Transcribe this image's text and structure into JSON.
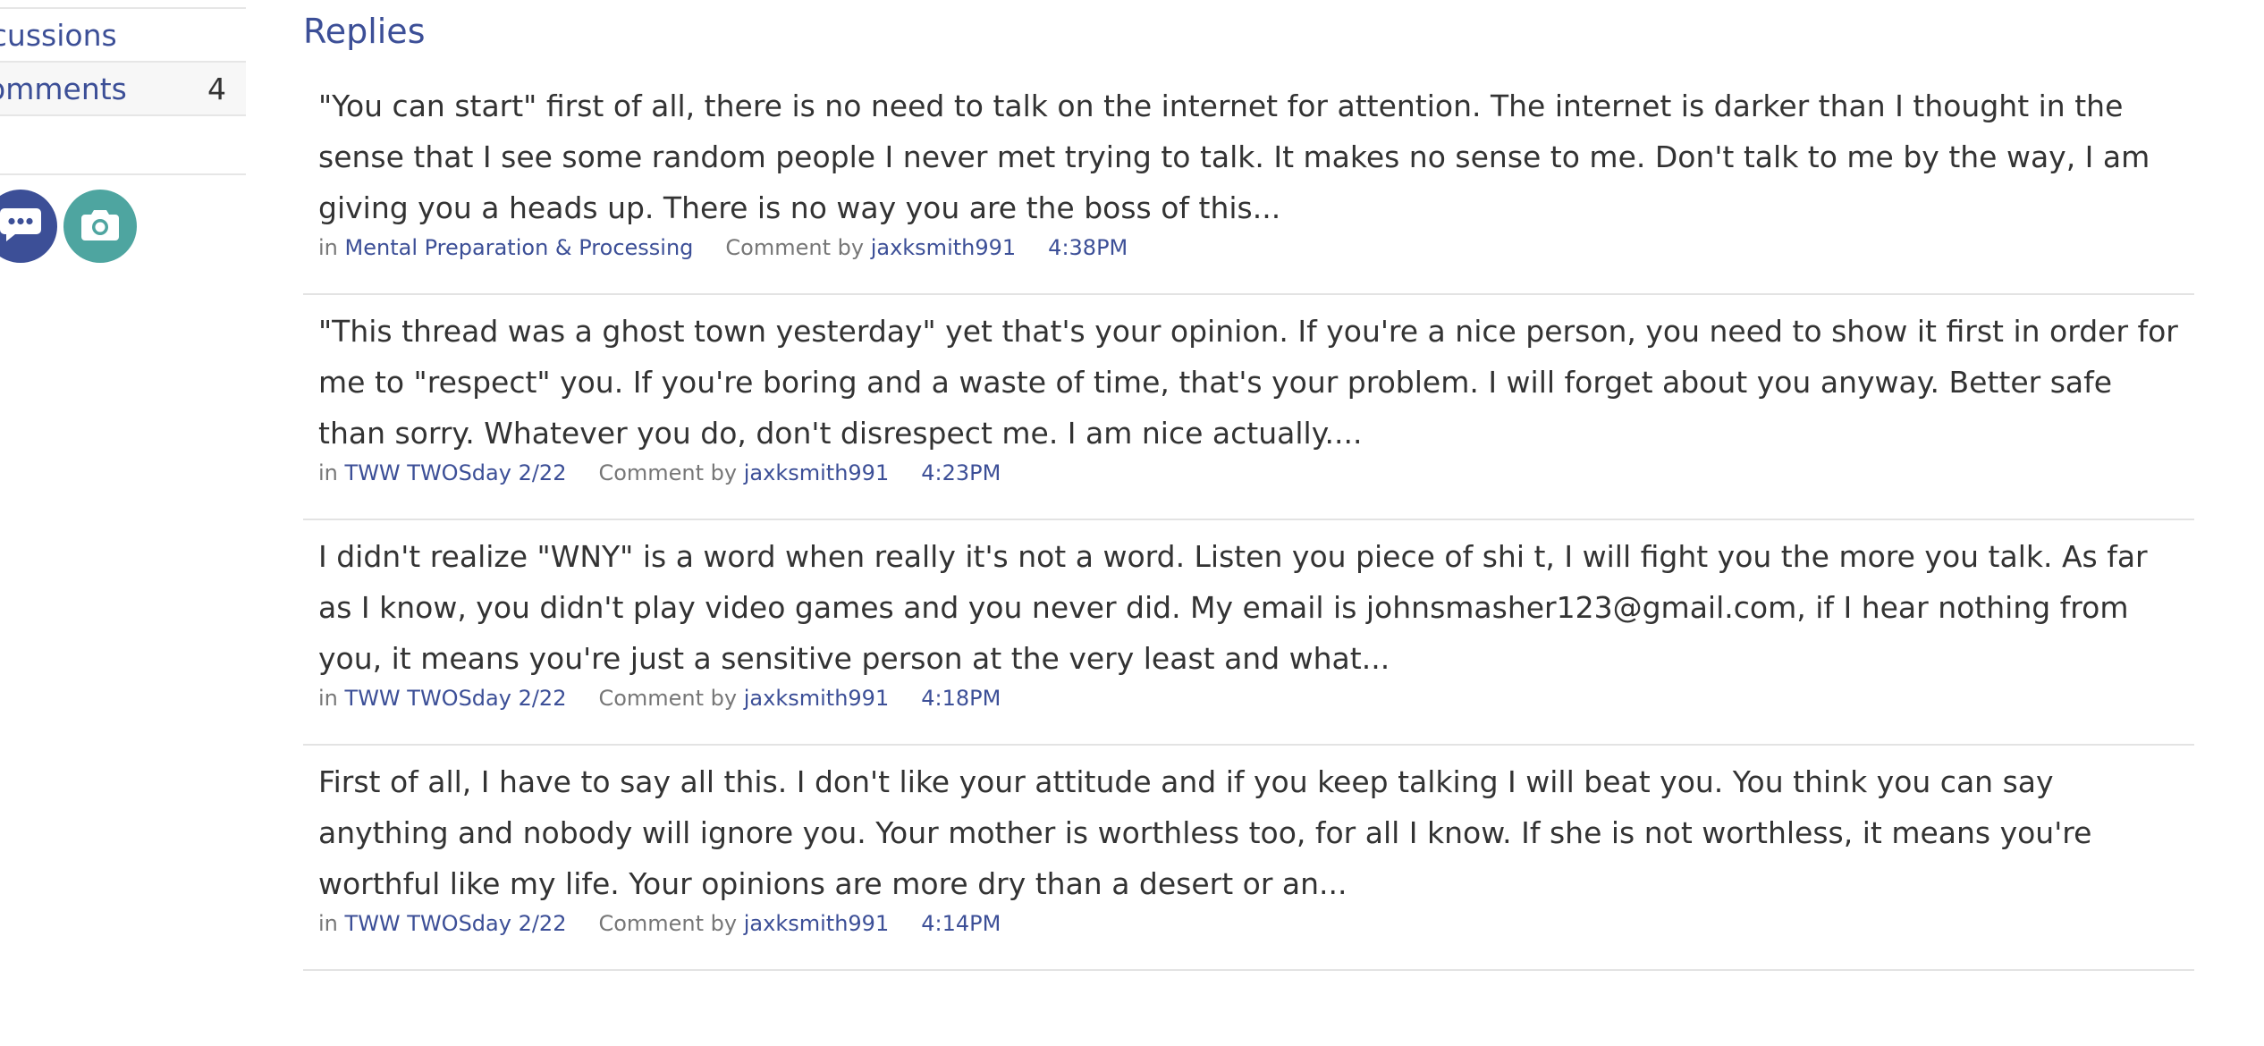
{
  "sidebar": {
    "items": [
      {
        "label": "Discussions"
      },
      {
        "label": "Comments",
        "count": "4"
      }
    ]
  },
  "replies": {
    "heading": "Replies",
    "in_label": "in",
    "comment_by_label": "Comment by",
    "items": [
      {
        "text": "\"You can start\" first of all, there is no need to talk on the internet for attention. The internet is darker than I thought in the sense that I see some random people I never met trying to talk. It makes no sense to me. Don't talk to me by the way, I am giving you a heads up. There is no way you are the boss of this...",
        "category": "Mental Preparation & Processing",
        "author": "jaxksmith991",
        "time": "4:38PM"
      },
      {
        "text": "\"This thread was a ghost town yesterday\" yet that's your opinion. If you're a nice person, you need to show it first in order for me to \"respect\" you. If you're boring and a waste of time, that's your problem. I will forget about you anyway. Better safe than sorry. Whatever you do, don't disrespect me. I am nice actually....",
        "category": "TWW TWOSday 2/22",
        "author": "jaxksmith991",
        "time": "4:23PM"
      },
      {
        "text": "I didn't realize \"WNY\" is a word when really it's not a word. Listen you piece of shi t, I will fight you the more you talk. As far as I know, you didn't play video games and you never did. My email is johnsmasher123@gmail.com, if I hear nothing from you, it means you're just a sensitive person at the very least and what...",
        "category": "TWW TWOSday 2/22",
        "author": "jaxksmith991",
        "time": "4:18PM"
      },
      {
        "text": "First of all, I have to say all this. I don't like your attitude and if you keep talking I will beat you. You think you can say anything and nobody will ignore you. Your mother is worthless too, for all I know. If she is not worthless, it means you're worthful like my life. Your opinions are more dry than a desert or an...",
        "category": "TWW TWOSday 2/22",
        "author": "jaxksmith991",
        "time": "4:14PM"
      }
    ]
  },
  "colors": {
    "accent": "#3c4f97",
    "teal": "#4ea5a0",
    "text": "#333333",
    "muted": "#777777",
    "divider": "#e3e3e3"
  },
  "icons": {
    "chat_button": "speech-bubble-icon",
    "camera_button": "camera-icon"
  }
}
